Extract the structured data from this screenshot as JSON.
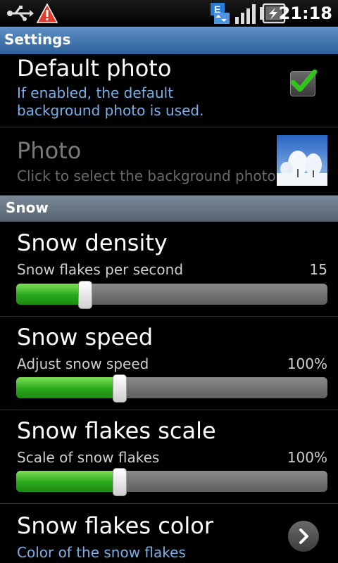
{
  "status_bar": {
    "time": "21:18",
    "icons": [
      "usb-icon",
      "warning-icon",
      "e-network-icon",
      "signal-icon",
      "battery-charging-icon"
    ]
  },
  "title_bar": {
    "title": "Settings"
  },
  "preferences": {
    "default_photo": {
      "title": "Default photo",
      "summary": "If enabled, the default background photo is used.",
      "checked": true
    },
    "photo": {
      "title": "Photo",
      "summary": "Click to select the background photo."
    }
  },
  "category": {
    "label": "Snow"
  },
  "sliders": {
    "density": {
      "title": "Snow density",
      "summary": "Snow flakes per second",
      "value": "15",
      "fraction": 0.22
    },
    "speed": {
      "title": "Snow speed",
      "summary": "Adjust snow speed",
      "value": "100%",
      "fraction": 0.33
    },
    "scale": {
      "title": "Snow flakes scale",
      "summary": "Scale of snow flakes",
      "value": "100%",
      "fraction": 0.33
    }
  },
  "color_pref": {
    "title": "Snow flakes color",
    "summary": "Color of the snow flakes"
  },
  "colors": {
    "accent": "#7ab0e6",
    "slider_fill": "#29a81c",
    "title_bar": "#3d6fa8"
  }
}
